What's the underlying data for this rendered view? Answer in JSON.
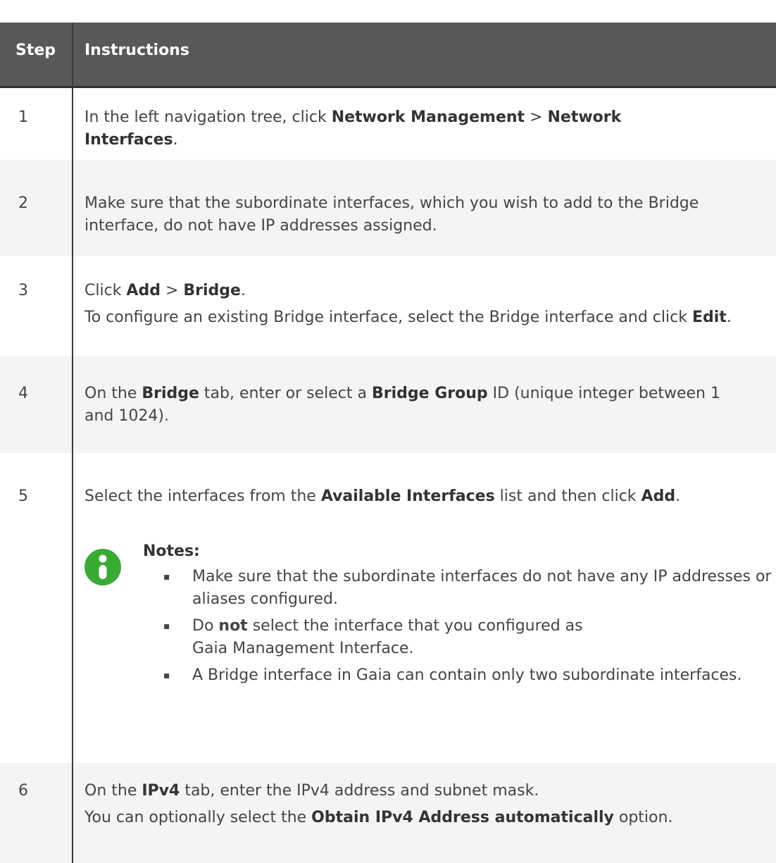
{
  "header": {
    "step": "Step",
    "instructions": "Instructions"
  },
  "rows": [
    {
      "num": "1",
      "segments": [
        {
          "text": "In the left navigation tree, click "
        },
        {
          "text": "Network Management",
          "bold": true
        },
        {
          "text": " > "
        },
        {
          "text": "Network Interfaces",
          "bold": true
        },
        {
          "text": "."
        }
      ]
    },
    {
      "num": "2",
      "segments": [
        {
          "text": "Make sure that the subordinate interfaces, which you wish to add to the Bridge interface, do not have IP addresses assigned."
        }
      ]
    },
    {
      "num": "3",
      "segments": [
        {
          "text": "Click "
        },
        {
          "text": "Add",
          "bold": true
        },
        {
          "text": " > "
        },
        {
          "text": "Bridge",
          "bold": true
        },
        {
          "text": "."
        }
      ],
      "segments2": [
        {
          "text": "To configure an existing Bridge interface, select the Bridge interface and click "
        },
        {
          "text": "Edit",
          "bold": true
        },
        {
          "text": "."
        }
      ]
    },
    {
      "num": "4",
      "segments": [
        {
          "text": "On the "
        },
        {
          "text": "Bridge",
          "bold": true
        },
        {
          "text": " tab, enter or select a "
        },
        {
          "text": "Bridge Group",
          "bold": true
        },
        {
          "text": " ID (unique integer between 1 and 1024)."
        }
      ]
    },
    {
      "num": "5",
      "segments": [
        {
          "text": "Select the interfaces from the "
        },
        {
          "text": "Available Interfaces",
          "bold": true
        },
        {
          "text": " list and then click "
        },
        {
          "text": "Add",
          "bold": true
        },
        {
          "text": "."
        }
      ]
    },
    {
      "num": "6",
      "segments": [
        {
          "text": "On the "
        },
        {
          "text": "IPv4",
          "bold": true
        },
        {
          "text": " tab, enter the IPv4 address and subnet mask."
        }
      ],
      "segments2": [
        {
          "text": "You can optionally select the "
        },
        {
          "text": "Obtain IPv4 Address automatically",
          "bold": true
        },
        {
          "text": " option."
        }
      ]
    }
  ],
  "note": {
    "title": "Notes:",
    "bullet_glyph": "▪",
    "icon": "info-icon",
    "icon_color": "#3aaa35",
    "items": [
      [
        {
          "text": "Make sure that the subordinate interfaces do not have any IP addresses or aliases configured."
        }
      ],
      [
        {
          "text": "Do "
        },
        {
          "text": "not",
          "bold": true
        },
        {
          "text": " select the interface that you configured as Gaia Management Interface."
        }
      ],
      [
        {
          "text": "A Bridge interface in Gaia can contain only two subordinate interfaces."
        }
      ]
    ]
  },
  "colors": {
    "header_bg": "#595959",
    "row_alt_bg": "#f4f4f4",
    "text": "#444444"
  }
}
